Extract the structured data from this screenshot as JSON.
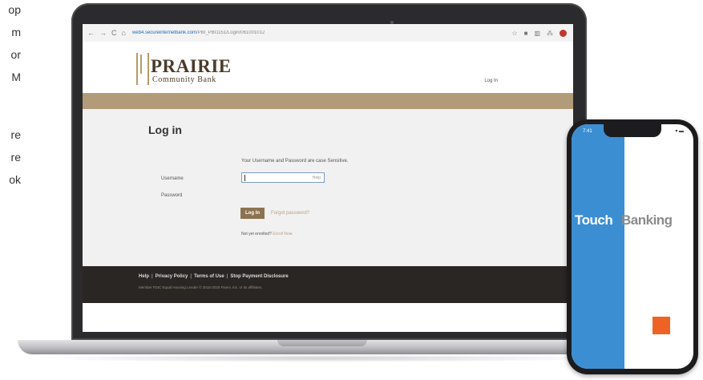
{
  "left_fragments": [
    "op",
    "m",
    "or",
    "M",
    "re",
    "re",
    "ok"
  ],
  "browser": {
    "url_host": "web4.secureinternetbank.com",
    "url_path": "/PBI_PBI1151/Login/061001012",
    "nav_icons": [
      "←",
      "→",
      "C",
      "⌂"
    ],
    "action_icons": [
      "☆",
      "■",
      "▥",
      "⁂"
    ]
  },
  "bank": {
    "logo_title": "PRAIRIE",
    "logo_subtitle": "Community Bank",
    "header_login": "Log In",
    "brand_color": "#b29b79",
    "page_title": "Log in",
    "notice": "Your Username and Password are case Sensitive.",
    "username_label": "Username",
    "password_label": "Password",
    "username_hint": "Help",
    "login_button": "Log In",
    "forgot_link": "Forgot password?",
    "not_enrolled_text": "Not yet enrolled?",
    "enroll_link": "Enroll Now.",
    "footer_links": [
      "Help",
      "Privacy Policy",
      "Terms of Use",
      "Stop Payment Disclosure"
    ],
    "footer_small": "Member FDIC Equal Housing Lender   © 2015-2020 Fiserv, Inc. or its affiliates."
  },
  "phone": {
    "time": "7:41",
    "status": "▾ ▬",
    "brand_touch": "Touch",
    "brand_banking": "Banking",
    "accent_blue": "#3c8ed3",
    "accent_orange": "#ee6324"
  }
}
